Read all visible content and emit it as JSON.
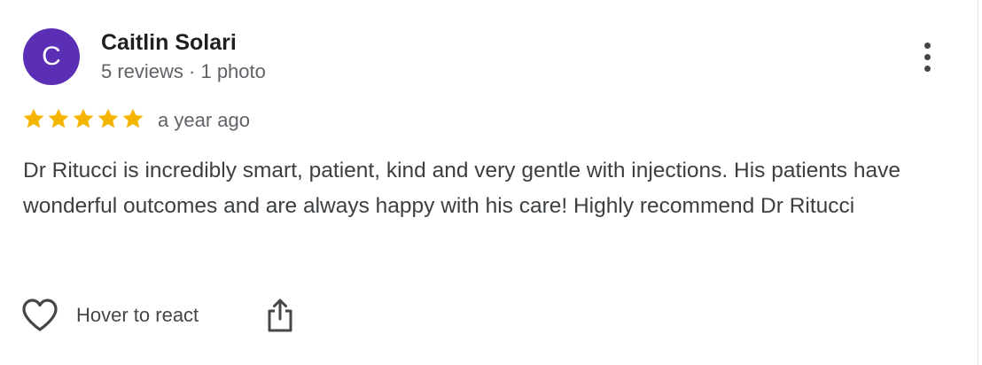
{
  "review": {
    "author": {
      "initial": "C",
      "name": "Caitlin Solari",
      "meta": "5 reviews · 1 photo",
      "avatar_color": "#5b2fb5"
    },
    "rating": 5,
    "rating_max": 5,
    "star_color": "#f4b400",
    "time": "a year ago",
    "text": "Dr Ritucci is incredibly smart, patient, kind and very gentle with injections. His patients have wonderful outcomes and are always happy with his care! Highly recommend Dr Ritucci",
    "actions": {
      "react_label": "Hover to react",
      "react_icon": "heart-outline-icon",
      "share_icon": "share-icon",
      "menu_icon": "more-vert-icon"
    }
  }
}
